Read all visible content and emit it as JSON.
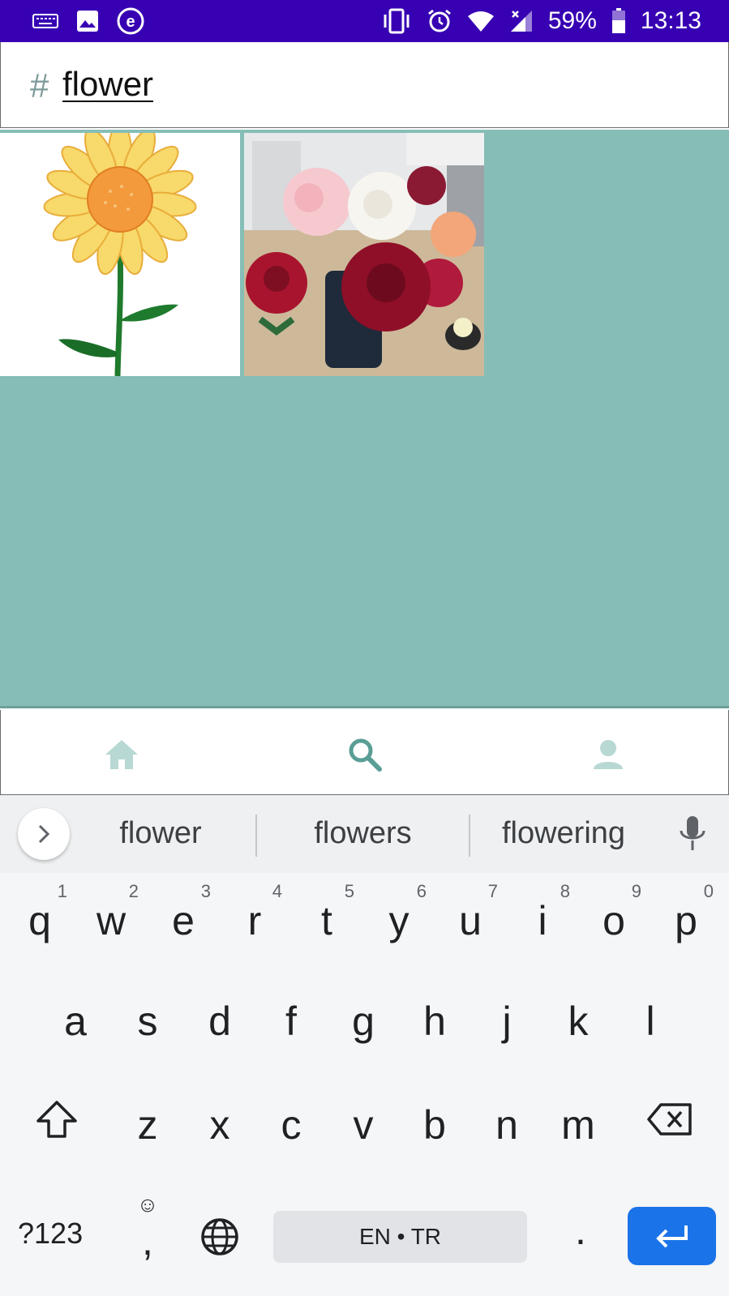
{
  "status_bar": {
    "battery": "59%",
    "time": "13:13",
    "icons": [
      "keyboard-icon",
      "image-icon",
      "e-app-icon",
      "vibrate-icon",
      "alarm-icon",
      "wifi-icon",
      "signal-icon",
      "battery-icon"
    ]
  },
  "search": {
    "hash_symbol": "#",
    "query": "flower"
  },
  "results": {
    "images": [
      "sunflower-image",
      "roses-bouquet-image"
    ]
  },
  "bottom_nav": {
    "items": [
      "home-icon",
      "search-icon",
      "profile-icon"
    ],
    "active": "search"
  },
  "keyboard": {
    "suggestions": [
      "flower",
      "flowers",
      "flowering"
    ],
    "row1": [
      {
        "ch": "q",
        "hint": "1"
      },
      {
        "ch": "w",
        "hint": "2"
      },
      {
        "ch": "e",
        "hint": "3"
      },
      {
        "ch": "r",
        "hint": "4"
      },
      {
        "ch": "t",
        "hint": "5"
      },
      {
        "ch": "y",
        "hint": "6"
      },
      {
        "ch": "u",
        "hint": "7"
      },
      {
        "ch": "i",
        "hint": "8"
      },
      {
        "ch": "o",
        "hint": "9"
      },
      {
        "ch": "p",
        "hint": "0"
      }
    ],
    "row2": [
      "a",
      "s",
      "d",
      "f",
      "g",
      "h",
      "j",
      "k",
      "l"
    ],
    "row3": [
      "z",
      "x",
      "c",
      "v",
      "b",
      "n",
      "m"
    ],
    "symbols_label": "?123",
    "comma": ",",
    "space_label": "EN • TR",
    "period": ".",
    "colors": {
      "enter": "#1a73e8",
      "accent_bar": "#3700b3",
      "results_bg": "#86beb7"
    }
  }
}
